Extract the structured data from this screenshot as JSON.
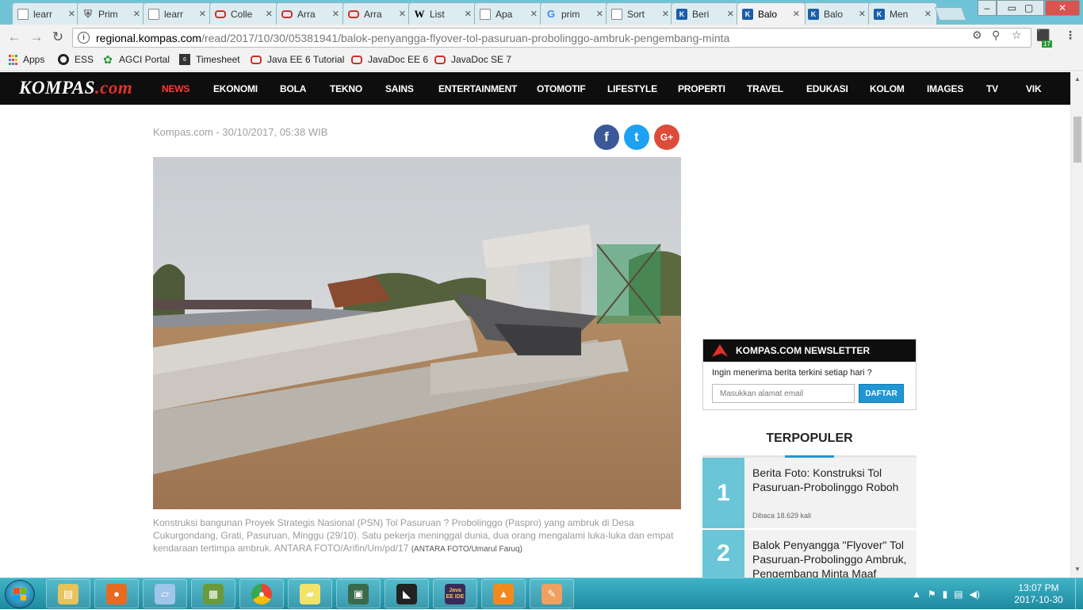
{
  "browser": {
    "tabs": [
      {
        "title": "learr",
        "icon": "doc"
      },
      {
        "title": "Prim",
        "icon": "shield"
      },
      {
        "title": "learr",
        "icon": "doc"
      },
      {
        "title": "Colle",
        "icon": "oracle"
      },
      {
        "title": "Arra",
        "icon": "oracle"
      },
      {
        "title": "Arra",
        "icon": "oracle"
      },
      {
        "title": "List",
        "icon": "wiki"
      },
      {
        "title": "Apa",
        "icon": "doc"
      },
      {
        "title": "prim",
        "icon": "google"
      },
      {
        "title": "Sort",
        "icon": "doc"
      },
      {
        "title": "Beri",
        "icon": "kompas"
      },
      {
        "title": "Balo",
        "icon": "kompas",
        "active": true
      },
      {
        "title": "Balo",
        "icon": "kompas"
      },
      {
        "title": "Men",
        "icon": "kompas"
      }
    ],
    "url_host": "regional.kompas.com",
    "url_path": "/read/2017/10/30/05381941/balok-penyangga-flyover-tol-pasuruan-probolinggo-ambruk-pengembang-minta",
    "extension_badge": "17",
    "bookmarks": [
      {
        "label": "Apps",
        "icon": "apps"
      },
      {
        "label": "ESS",
        "icon": "ess"
      },
      {
        "label": "AGCI Portal",
        "icon": "agci"
      },
      {
        "label": "Timesheet",
        "icon": "time"
      },
      {
        "label": "Java EE 6 Tutorial",
        "icon": "oracle"
      },
      {
        "label": "JavaDoc EE 6",
        "icon": "oracle"
      },
      {
        "label": "JavaDoc SE 7",
        "icon": "oracle"
      }
    ]
  },
  "site": {
    "logo_main": "KOMPAS",
    "logo_suffix": ".com",
    "nav": [
      "NEWS",
      "EKONOMI",
      "BOLA",
      "TEKNO",
      "SAINS",
      "ENTERTAINMENT",
      "OTOMOTIF",
      "LIFESTYLE",
      "PROPERTI",
      "TRAVEL",
      "EDUKASI",
      "KOLOM",
      "IMAGES",
      "TV",
      "VIK"
    ],
    "nav_active": "NEWS"
  },
  "article": {
    "byline": "Kompas.com - 30/10/2017, 05:38 WIB",
    "share": [
      {
        "name": "facebook",
        "glyph": "f",
        "color": "#3b5998"
      },
      {
        "name": "twitter",
        "glyph": "t",
        "color": "#1da1f2"
      },
      {
        "name": "google-plus",
        "glyph": "G+",
        "color": "#dd4b39"
      }
    ],
    "caption": "Konstruksi bangunan Proyek Strategis Nasional (PSN) Tol Pasuruan ? Probolinggo (Paspro) yang ambruk di Desa Cukurgondang, Grati, Pasuruan, Minggu (29/10). Satu pekerja meninggal dunia, dua orang mengalami luka-luka dan empat kendaraan tertimpa ambruk. ANTARA FOTO/Arifin/Um/pd/17",
    "caption_credit": "(ANTARA FOTO/Umarul Faruq)"
  },
  "newsletter": {
    "title": "KOMPAS.COM NEWSLETTER",
    "question": "Ingin menerima berita terkini setiap hari ?",
    "placeholder": "Masukkan alamat email",
    "button": "DAFTAR"
  },
  "popular": {
    "title": "TERPOPULER",
    "items": [
      {
        "rank": "1",
        "title": "Berita Foto: Konstruksi Tol Pasuruan-Probolinggo Roboh",
        "reads": "Dibaca 18.629 kali"
      },
      {
        "rank": "2",
        "title": "Balok Penyangga \"Flyover\" Tol Pasuruan-Probolinggo Ambruk, Pengembang Minta Maaf",
        "reads": ""
      }
    ]
  },
  "taskbar": {
    "apps": [
      "explorer",
      "firefox",
      "notepad",
      "spreadsheet",
      "chrome",
      "sticky-notes",
      "monitor",
      "image-viewer",
      "java-ee-ide",
      "vlc",
      "paint"
    ],
    "java_ide_label": "Java EE IDE",
    "time": "13:07 PM",
    "date": "2017-10-30"
  }
}
